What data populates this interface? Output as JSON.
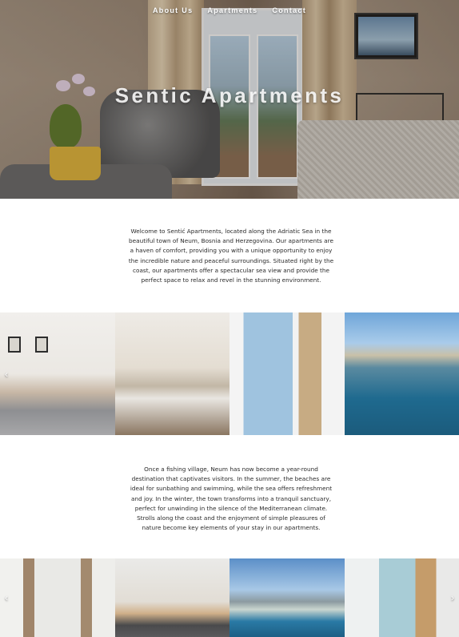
{
  "nav": {
    "items": [
      {
        "label": "About Us"
      },
      {
        "label": "Apartments"
      },
      {
        "label": "Contact"
      }
    ]
  },
  "hero": {
    "title": "Sentic Apartments"
  },
  "intro": {
    "text": "Welcome to Sentić Apartments, located along the Adriatic Sea in the beautiful town of Neum, Bosnia and Herzegovina. Our apartments are a haven of comfort, providing you with a unique opportunity to enjoy the incredible nature and peaceful surroundings. Situated right by the coast, our apartments offer a spectacular sea view and provide the perfect space to relax and revel in the stunning environment."
  },
  "about_neum": {
    "text": "Once a fishing village, Neum has now become a year-round destination that captivates visitors. In the summer, the beaches are ideal for sunbathing and swimming, while the sea offers refreshment and joy. In the winter, the town transforms into a tranquil sanctuary, perfect for unwinding in the silence of the Mediterranean climate. Strolls along the coast and the enjoyment of simple pleasures of nature become key elements of your stay in our apartments."
  },
  "gallery_controls": {
    "prev_glyph": "‹",
    "next_glyph": "›"
  }
}
